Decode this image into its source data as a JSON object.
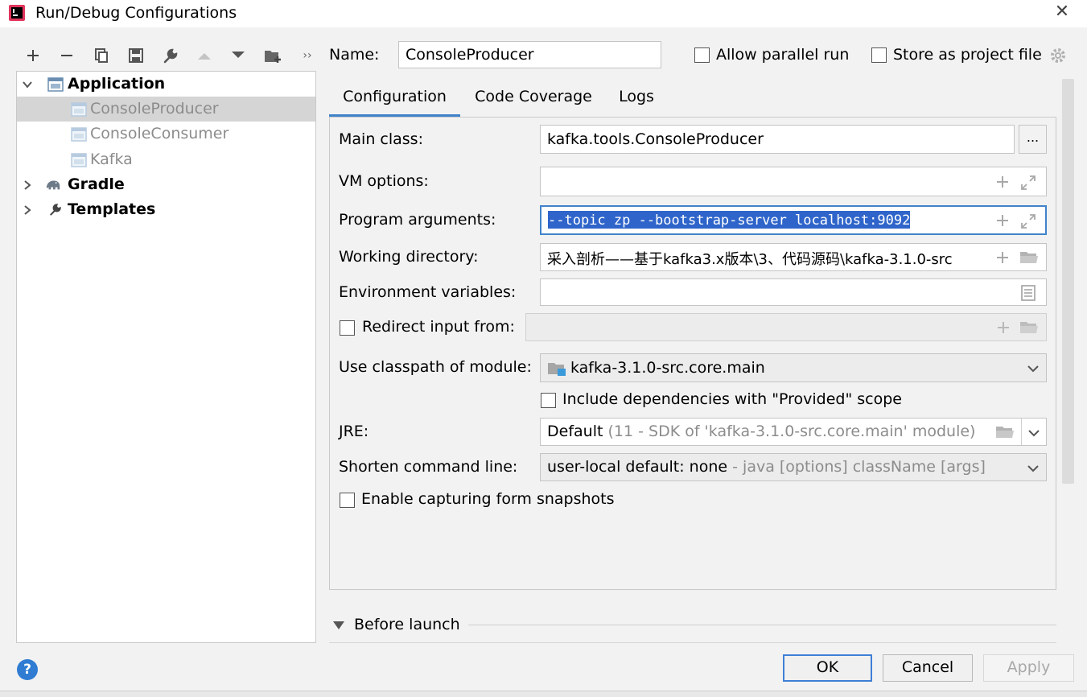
{
  "window": {
    "title": "Run/Debug Configurations",
    "close_glyph": "✕"
  },
  "toolbar": {
    "more_glyph": "››"
  },
  "tree": {
    "items": [
      {
        "label": "Application",
        "style": "bold",
        "expanded": true
      },
      {
        "label": "ConsoleProducer",
        "style": "dim",
        "selected": true
      },
      {
        "label": "ConsoleConsumer",
        "style": "dim"
      },
      {
        "label": "Kafka",
        "style": "dim"
      },
      {
        "label": "Gradle",
        "style": "bold",
        "expanded": false
      },
      {
        "label": "Templates",
        "style": "bold",
        "expanded": false
      }
    ]
  },
  "header": {
    "name_label": "Name:",
    "name_value": "ConsoleProducer",
    "allow_parallel_label": "Allow parallel run",
    "allow_parallel_checked": false,
    "store_project_label": "Store as project file",
    "store_project_checked": false
  },
  "tabs": [
    {
      "label": "Configuration",
      "active": true
    },
    {
      "label": "Code Coverage",
      "active": false
    },
    {
      "label": "Logs",
      "active": false
    }
  ],
  "form": {
    "main_class_label": "Main class:",
    "main_class_value": "kafka.tools.ConsoleProducer",
    "browse_glyph": "...",
    "vm_options_label": "VM options:",
    "vm_options_value": "",
    "program_args_label": "Program arguments:",
    "program_args_value": "--topic zp --bootstrap-server localhost:9092",
    "working_dir_label": "Working directory:",
    "working_dir_value": "采入剖析——基于kafka3.x版本\\3、代码源码\\kafka-3.1.0-src",
    "env_vars_label": "Environment variables:",
    "env_vars_value": "",
    "redirect_input_label": "Redirect input from:",
    "redirect_input_checked": false,
    "classpath_label": "Use classpath of module:",
    "classpath_value": "kafka-3.1.0-src.core.main",
    "include_deps_label": "Include dependencies with \"Provided\" scope",
    "include_deps_checked": false,
    "jre_label": "JRE:",
    "jre_value": "Default",
    "jre_hint": "(11 - SDK of 'kafka-3.1.0-src.core.main' module)",
    "shorten_label": "Shorten command line:",
    "shorten_value": "user-local default: none",
    "shorten_hint": "- java [options] className [args]",
    "capture_snapshots_label": "Enable capturing form snapshots",
    "capture_snapshots_checked": false
  },
  "before_launch": {
    "label": "Before launch"
  },
  "footer": {
    "help_glyph": "?",
    "ok_label": "OK",
    "cancel_label": "Cancel",
    "apply_label": "Apply"
  },
  "colors": {
    "accent": "#4083c9",
    "selection": "#2f65ca",
    "tree_selected": "#d5d5d5"
  }
}
